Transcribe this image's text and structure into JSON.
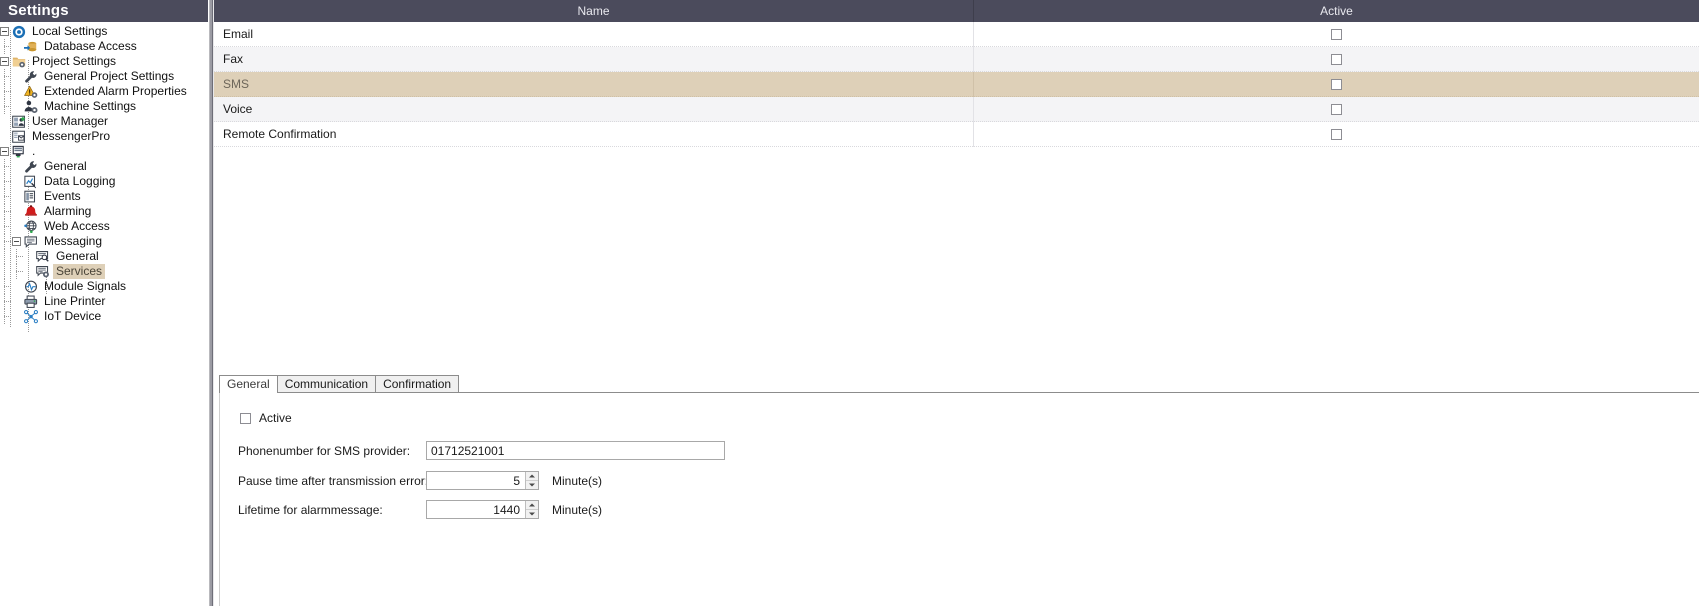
{
  "window": {
    "sidebar_title": "Settings",
    "accent_header_bg": "#4b4b5c",
    "selection_bg": "#ded0b8"
  },
  "sidebar": {
    "title": "Settings",
    "items": [
      {
        "label": "Local Settings",
        "icon": "gear-circle-icon",
        "depth": 0,
        "expander": "expanded",
        "selected": false
      },
      {
        "label": "Database Access",
        "icon": "database-arrow-icon",
        "depth": 1,
        "expander": "none",
        "selected": false
      },
      {
        "label": "Project Settings",
        "icon": "folder-gear-icon",
        "depth": 0,
        "expander": "expanded",
        "selected": false
      },
      {
        "label": "General Project Settings",
        "icon": "wrench-icon",
        "depth": 1,
        "expander": "none",
        "selected": false
      },
      {
        "label": "Extended Alarm Properties",
        "icon": "warning-gear-icon",
        "depth": 1,
        "expander": "none",
        "selected": false
      },
      {
        "label": "Machine Settings",
        "icon": "person-gear-icon",
        "depth": 1,
        "expander": "none",
        "selected": false
      },
      {
        "label": "User Manager",
        "icon": "users-icon",
        "depth": 0,
        "expander": "none",
        "selected": false
      },
      {
        "label": "MessengerPro",
        "icon": "messenger-icon",
        "depth": 0,
        "expander": "none",
        "selected": false
      },
      {
        "label": ".",
        "icon": "server-icon",
        "depth": 0,
        "expander": "expanded",
        "selected": false
      },
      {
        "label": "General",
        "icon": "wrench-icon",
        "depth": 1,
        "expander": "none",
        "selected": false
      },
      {
        "label": "Data Logging",
        "icon": "data-logging-icon",
        "depth": 1,
        "expander": "none",
        "selected": false
      },
      {
        "label": "Events",
        "icon": "events-icon",
        "depth": 1,
        "expander": "none",
        "selected": false
      },
      {
        "label": "Alarming",
        "icon": "alarm-bell-icon",
        "depth": 1,
        "expander": "none",
        "selected": false
      },
      {
        "label": "Web Access",
        "icon": "globe-icon",
        "depth": 1,
        "expander": "none",
        "selected": false
      },
      {
        "label": "Messaging",
        "icon": "speech-bubble-icon",
        "depth": 1,
        "expander": "expanded",
        "selected": false
      },
      {
        "label": "General",
        "icon": "message-search-icon",
        "depth": 2,
        "expander": "none",
        "selected": false
      },
      {
        "label": "Services",
        "icon": "message-gear-icon",
        "depth": 2,
        "expander": "none",
        "selected": true
      },
      {
        "label": "Module Signals",
        "icon": "signal-wave-icon",
        "depth": 1,
        "expander": "none",
        "selected": false
      },
      {
        "label": "Line Printer",
        "icon": "printer-icon",
        "depth": 1,
        "expander": "none",
        "selected": false
      },
      {
        "label": "IoT Device",
        "icon": "iot-device-icon",
        "depth": 1,
        "expander": "none",
        "selected": false
      }
    ]
  },
  "grid": {
    "columns": [
      {
        "key": "name",
        "label": "Name"
      },
      {
        "key": "active",
        "label": "Active"
      }
    ],
    "rows": [
      {
        "name": "Email",
        "active": false,
        "selected": false
      },
      {
        "name": "Fax",
        "active": false,
        "selected": false
      },
      {
        "name": "SMS",
        "active": false,
        "selected": true
      },
      {
        "name": "Voice",
        "active": false,
        "selected": false
      },
      {
        "name": "Remote Confirmation",
        "active": false,
        "selected": false
      }
    ]
  },
  "detail": {
    "tabs": [
      {
        "label": "General",
        "active": true
      },
      {
        "label": "Communication",
        "active": false
      },
      {
        "label": "Confirmation",
        "active": false
      }
    ],
    "general": {
      "active_checkbox_label": "Active",
      "active_checked": false,
      "fields": [
        {
          "label": "Phonenumber for SMS provider:",
          "value": "01712521001",
          "unit": "",
          "kind": "text"
        },
        {
          "label": "Pause time after transmission error:",
          "value": "5",
          "unit": "Minute(s)",
          "kind": "spinner"
        },
        {
          "label": "Lifetime for alarmmessage:",
          "value": "1440",
          "unit": "Minute(s)",
          "kind": "spinner"
        }
      ]
    }
  }
}
